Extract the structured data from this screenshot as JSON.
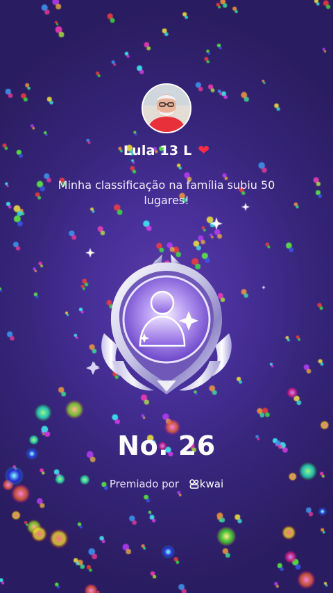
{
  "profile": {
    "username": "Lula 13 L",
    "avatar_icon": "person-photo",
    "heart_icon": "red-heart"
  },
  "message": {
    "text": "Minha classificação na família subiu 50 lugares!"
  },
  "badge": {
    "icon": "family-member-medal",
    "rank_label": "No. 26"
  },
  "footer": {
    "awarded_by_label": "Premiado por",
    "brand_name": "kwai"
  },
  "colors": {
    "background_center": "#5b3aa8",
    "background_edge": "#2a1c60",
    "heart": "#ff2b44",
    "text": "#ffffff"
  }
}
